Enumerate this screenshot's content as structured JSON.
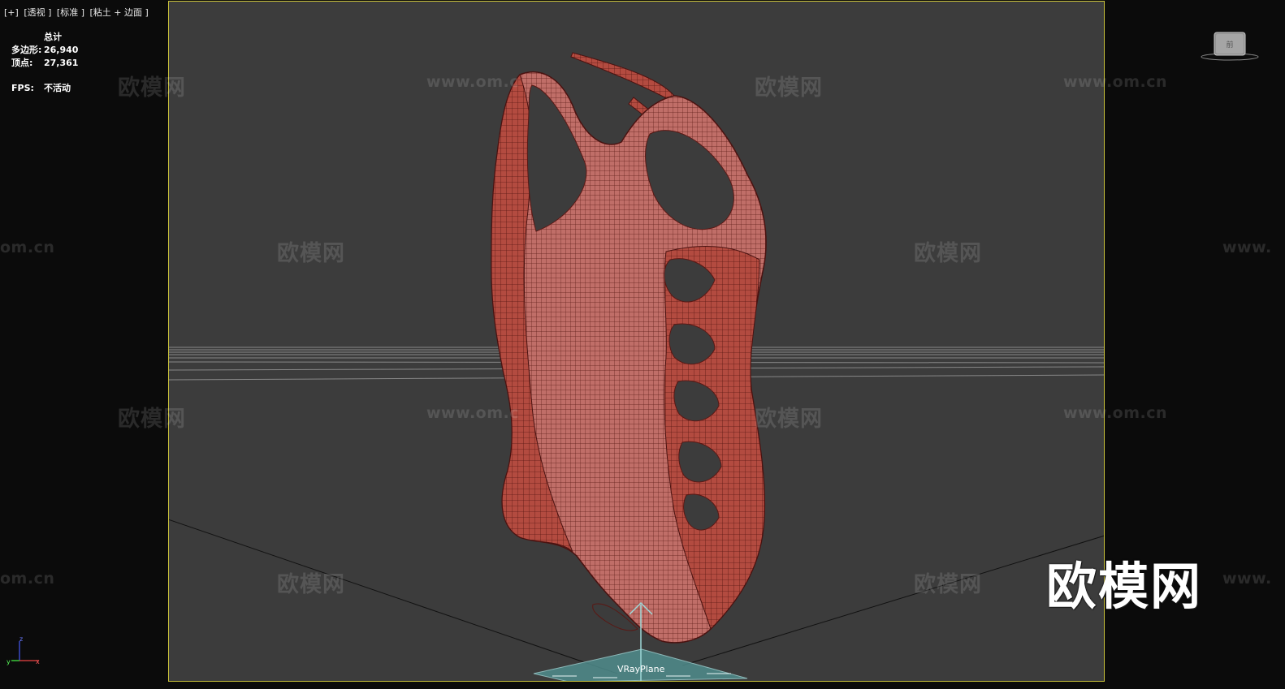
{
  "viewport": {
    "label_items": [
      "[+]",
      "[透视 ]",
      "[标准 ]",
      "[粘土 + 边面 ]"
    ]
  },
  "stats": {
    "header": "总计",
    "polys_label": "多边形:",
    "polys_value": "26,940",
    "verts_label": "顶点:",
    "verts_value": "27,361",
    "fps_label": "FPS:",
    "fps_value": "不活动"
  },
  "watermarks": {
    "brand_text": "欧模网",
    "url_text": "www.om.cn",
    "url_partial_left": "om.cn",
    "url_partial_right": "www.",
    "url_partial_center": "www.om.c",
    "corner_brand": "欧模网"
  },
  "scene": {
    "object_label": "VRayPlane",
    "mesh_color": "#b5453c",
    "mesh_dark_color": "#6e1e1a",
    "safe_frame_color": "#c9c23a",
    "plane_color": "#4f8c8c"
  },
  "axis": {
    "x": "x",
    "y": "y",
    "z": "z"
  },
  "viewcube": {
    "face_label": "前"
  }
}
